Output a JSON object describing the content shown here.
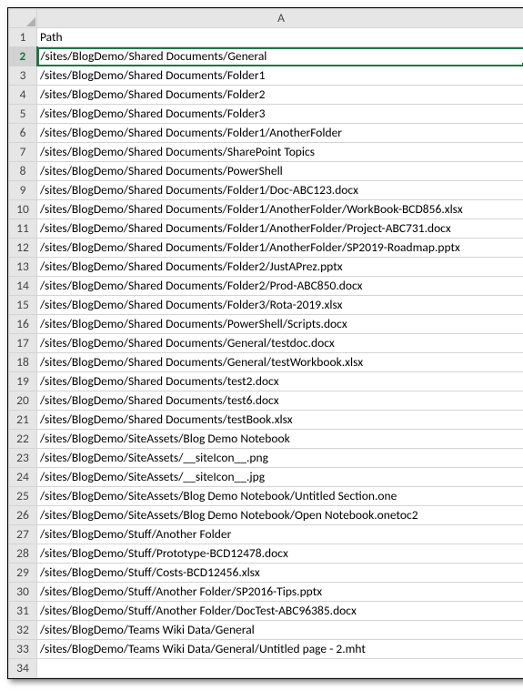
{
  "chart_data": {
    "type": "table",
    "title": "",
    "columns": [
      "Path"
    ],
    "rows": [
      [
        "/sites/BlogDemo/Shared Documents/General"
      ],
      [
        "/sites/BlogDemo/Shared Documents/Folder1"
      ],
      [
        "/sites/BlogDemo/Shared Documents/Folder2"
      ],
      [
        "/sites/BlogDemo/Shared Documents/Folder3"
      ],
      [
        "/sites/BlogDemo/Shared Documents/Folder1/AnotherFolder"
      ],
      [
        "/sites/BlogDemo/Shared Documents/SharePoint Topics"
      ],
      [
        "/sites/BlogDemo/Shared Documents/PowerShell"
      ],
      [
        "/sites/BlogDemo/Shared Documents/Folder1/Doc-ABC123.docx"
      ],
      [
        "/sites/BlogDemo/Shared Documents/Folder1/AnotherFolder/WorkBook-BCD856.xlsx"
      ],
      [
        "/sites/BlogDemo/Shared Documents/Folder1/AnotherFolder/Project-ABC731.docx"
      ],
      [
        "/sites/BlogDemo/Shared Documents/Folder1/AnotherFolder/SP2019-Roadmap.pptx"
      ],
      [
        "/sites/BlogDemo/Shared Documents/Folder2/JustAPrez.pptx"
      ],
      [
        "/sites/BlogDemo/Shared Documents/Folder2/Prod-ABC850.docx"
      ],
      [
        "/sites/BlogDemo/Shared Documents/Folder3/Rota-2019.xlsx"
      ],
      [
        "/sites/BlogDemo/Shared Documents/PowerShell/Scripts.docx"
      ],
      [
        "/sites/BlogDemo/Shared Documents/General/testdoc.docx"
      ],
      [
        "/sites/BlogDemo/Shared Documents/General/testWorkbook.xlsx"
      ],
      [
        "/sites/BlogDemo/Shared Documents/test2.docx"
      ],
      [
        "/sites/BlogDemo/Shared Documents/test6.docx"
      ],
      [
        "/sites/BlogDemo/Shared Documents/testBook.xlsx"
      ],
      [
        "/sites/BlogDemo/SiteAssets/Blog Demo Notebook"
      ],
      [
        "/sites/BlogDemo/SiteAssets/__siteIcon__.png"
      ],
      [
        "/sites/BlogDemo/SiteAssets/__siteIcon__.jpg"
      ],
      [
        "/sites/BlogDemo/SiteAssets/Blog Demo Notebook/Untitled Section.one"
      ],
      [
        "/sites/BlogDemo/SiteAssets/Blog Demo Notebook/Open Notebook.onetoc2"
      ],
      [
        "/sites/BlogDemo/Stuff/Another Folder"
      ],
      [
        "/sites/BlogDemo/Stuff/Prototype-BCD12478.docx"
      ],
      [
        "/sites/BlogDemo/Stuff/Costs-BCD12456.xlsx"
      ],
      [
        "/sites/BlogDemo/Stuff/Another Folder/SP2016-Tips.pptx"
      ],
      [
        "/sites/BlogDemo/Stuff/Another Folder/DocTest-ABC96385.docx"
      ],
      [
        "/sites/BlogDemo/Teams Wiki Data/General"
      ],
      [
        "/sites/BlogDemo/Teams Wiki Data/General/Untitled page - 2.mht"
      ]
    ]
  },
  "column_letter": "A",
  "selected_row": 2,
  "empty_row_after": 34
}
